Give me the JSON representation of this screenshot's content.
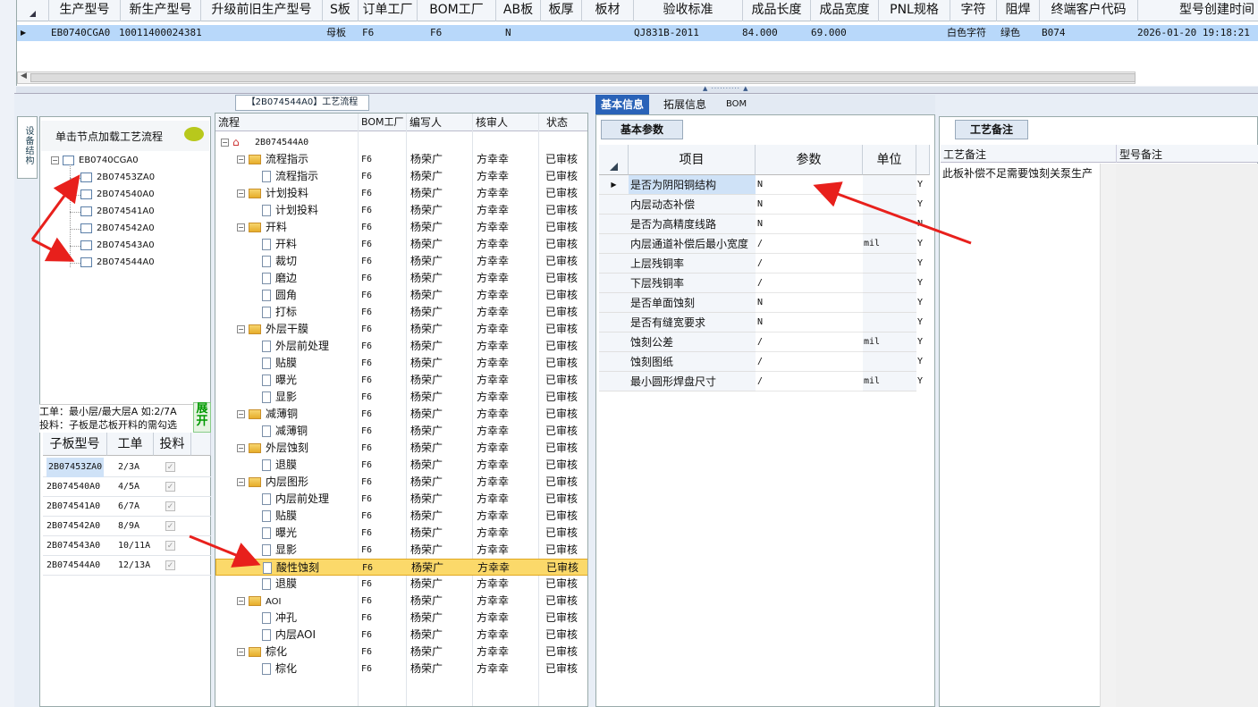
{
  "top_grid": {
    "headers": [
      "生产型号",
      "新生产型号",
      "升级前旧生产型号",
      "S板",
      "订单工厂",
      "BOM工厂",
      "AB板",
      "板厚",
      "板材",
      "验收标准",
      "成品长度",
      "成品宽度",
      "PNL规格",
      "字符",
      "阻焊",
      "终端客户代码",
      "型号创建时间"
    ],
    "row": [
      "EB0740CGA0",
      "10011400024381",
      "",
      "母板",
      "F6",
      "F6",
      "N",
      "",
      "",
      "QJ831B-2011",
      "84.000",
      "69.000",
      "",
      "白色字符",
      "绿色",
      "B074",
      "2026-01-20 19:18:21"
    ]
  },
  "left_panel": {
    "vertical_tab": "设备结构",
    "hint": "单击节点加载工艺流程",
    "tree_root": "EB0740CGA0",
    "tree_children": [
      "2B07453ZA0",
      "2B074540A0",
      "2B074541A0",
      "2B074542A0",
      "2B074543A0",
      "2B074544A0"
    ],
    "info_line1": "工单：最小层/最大层A 如:2/7A",
    "info_line2": "投料：子板是芯板开料的需勾选",
    "expand_label": "展开",
    "sub_headers": [
      "子板型号",
      "工单",
      "投料"
    ],
    "sub_rows": [
      {
        "model": "2B07453ZA0",
        "order": "2/3A"
      },
      {
        "model": "2B074540A0",
        "order": "4/5A"
      },
      {
        "model": "2B074541A0",
        "order": "6/7A"
      },
      {
        "model": "2B074542A0",
        "order": "8/9A"
      },
      {
        "model": "2B074543A0",
        "order": "10/11A"
      },
      {
        "model": "2B074544A0",
        "order": "12/13A"
      }
    ],
    "check_glyph": "✓"
  },
  "process": {
    "title": "【2B074544A0】工艺流程",
    "headers": [
      "流程",
      "BOM工厂",
      "编写人",
      "核审人",
      "状态"
    ],
    "root": "2B074544A0",
    "rows": [
      {
        "level": 1,
        "name": "流程指示",
        "f": "F6",
        "w": "杨荣广",
        "r": "方幸幸",
        "s": "已审核"
      },
      {
        "level": 2,
        "name": "流程指示",
        "f": "F6",
        "w": "杨荣广",
        "r": "方幸幸",
        "s": "已审核"
      },
      {
        "level": 1,
        "name": "计划投料",
        "f": "F6",
        "w": "杨荣广",
        "r": "方幸幸",
        "s": "已审核"
      },
      {
        "level": 2,
        "name": "计划投料",
        "f": "F6",
        "w": "杨荣广",
        "r": "方幸幸",
        "s": "已审核"
      },
      {
        "level": 1,
        "name": "开料",
        "f": "F6",
        "w": "杨荣广",
        "r": "方幸幸",
        "s": "已审核"
      },
      {
        "level": 2,
        "name": "开料",
        "f": "F6",
        "w": "杨荣广",
        "r": "方幸幸",
        "s": "已审核"
      },
      {
        "level": 2,
        "name": "裁切",
        "f": "F6",
        "w": "杨荣广",
        "r": "方幸幸",
        "s": "已审核"
      },
      {
        "level": 2,
        "name": "磨边",
        "f": "F6",
        "w": "杨荣广",
        "r": "方幸幸",
        "s": "已审核"
      },
      {
        "level": 2,
        "name": "圆角",
        "f": "F6",
        "w": "杨荣广",
        "r": "方幸幸",
        "s": "已审核"
      },
      {
        "level": 2,
        "name": "打标",
        "f": "F6",
        "w": "杨荣广",
        "r": "方幸幸",
        "s": "已审核"
      },
      {
        "level": 1,
        "name": "外层干膜",
        "f": "F6",
        "w": "杨荣广",
        "r": "方幸幸",
        "s": "已审核"
      },
      {
        "level": 2,
        "name": "外层前处理",
        "f": "F6",
        "w": "杨荣广",
        "r": "方幸幸",
        "s": "已审核"
      },
      {
        "level": 2,
        "name": "贴膜",
        "f": "F6",
        "w": "杨荣广",
        "r": "方幸幸",
        "s": "已审核"
      },
      {
        "level": 2,
        "name": "曝光",
        "f": "F6",
        "w": "杨荣广",
        "r": "方幸幸",
        "s": "已审核"
      },
      {
        "level": 2,
        "name": "显影",
        "f": "F6",
        "w": "杨荣广",
        "r": "方幸幸",
        "s": "已审核"
      },
      {
        "level": 1,
        "name": "减薄铜",
        "f": "F6",
        "w": "杨荣广",
        "r": "方幸幸",
        "s": "已审核"
      },
      {
        "level": 2,
        "name": "减薄铜",
        "f": "F6",
        "w": "杨荣广",
        "r": "方幸幸",
        "s": "已审核"
      },
      {
        "level": 1,
        "name": "外层蚀刻",
        "f": "F6",
        "w": "杨荣广",
        "r": "方幸幸",
        "s": "已审核"
      },
      {
        "level": 2,
        "name": "退膜",
        "f": "F6",
        "w": "杨荣广",
        "r": "方幸幸",
        "s": "已审核"
      },
      {
        "level": 1,
        "name": "内层图形",
        "f": "F6",
        "w": "杨荣广",
        "r": "方幸幸",
        "s": "已审核"
      },
      {
        "level": 2,
        "name": "内层前处理",
        "f": "F6",
        "w": "杨荣广",
        "r": "方幸幸",
        "s": "已审核"
      },
      {
        "level": 2,
        "name": "贴膜",
        "f": "F6",
        "w": "杨荣广",
        "r": "方幸幸",
        "s": "已审核"
      },
      {
        "level": 2,
        "name": "曝光",
        "f": "F6",
        "w": "杨荣广",
        "r": "方幸幸",
        "s": "已审核"
      },
      {
        "level": 2,
        "name": "显影",
        "f": "F6",
        "w": "杨荣广",
        "r": "方幸幸",
        "s": "已审核"
      },
      {
        "level": 2,
        "name": "酸性蚀刻",
        "f": "F6",
        "w": "杨荣广",
        "r": "方幸幸",
        "s": "已审核",
        "selected": true
      },
      {
        "level": 2,
        "name": "退膜",
        "f": "F6",
        "w": "杨荣广",
        "r": "方幸幸",
        "s": "已审核"
      },
      {
        "level": 1,
        "name": "AOI",
        "f": "F6",
        "w": "杨荣广",
        "r": "方幸幸",
        "s": "已审核"
      },
      {
        "level": 2,
        "name": "冲孔",
        "f": "F6",
        "w": "杨荣广",
        "r": "方幸幸",
        "s": "已审核"
      },
      {
        "level": 2,
        "name": "内层AOI",
        "f": "F6",
        "w": "杨荣广",
        "r": "方幸幸",
        "s": "已审核"
      },
      {
        "level": 1,
        "name": "棕化",
        "f": "F6",
        "w": "杨荣广",
        "r": "方幸幸",
        "s": "已审核"
      },
      {
        "level": 2,
        "name": "棕化",
        "f": "F6",
        "w": "杨荣广",
        "r": "方幸幸",
        "s": "已审核"
      }
    ]
  },
  "right_panel": {
    "tabs": [
      "基本信息",
      "拓展信息",
      "BOM"
    ],
    "sub_tab": "基本参数",
    "headers": [
      "项目",
      "参数",
      "单位"
    ],
    "rows": [
      {
        "item": "是否为阴阳铜结构",
        "param": "N",
        "unit": "",
        "flag": "Y"
      },
      {
        "item": "内层动态补偿",
        "param": "N",
        "unit": "",
        "flag": "Y"
      },
      {
        "item": "是否为高精度线路",
        "param": "N",
        "unit": "",
        "flag": "N"
      },
      {
        "item": "内层通道补偿后最小宽度",
        "param": "/",
        "unit": "mil",
        "flag": "Y"
      },
      {
        "item": "上层残铜率",
        "param": "/",
        "unit": "",
        "flag": "Y"
      },
      {
        "item": "下层残铜率",
        "param": "/",
        "unit": "",
        "flag": "Y"
      },
      {
        "item": "是否单面蚀刻",
        "param": "N",
        "unit": "",
        "flag": "Y"
      },
      {
        "item": "是否有缝宽要求",
        "param": "N",
        "unit": "",
        "flag": "Y"
      },
      {
        "item": "蚀刻公差",
        "param": "/",
        "unit": "mil",
        "flag": "Y"
      },
      {
        "item": "蚀刻图纸",
        "param": "/",
        "unit": "",
        "flag": "Y"
      },
      {
        "item": "最小圆形焊盘尺寸",
        "param": "/",
        "unit": "mil",
        "flag": "Y"
      }
    ]
  },
  "remarks": {
    "tab": "工艺备注",
    "headers": [
      "工艺备注",
      "型号备注"
    ],
    "text": "此板补偿不足需要蚀刻关泵生产"
  },
  "colors": {
    "arrow": "#e8201c",
    "selected_row": "#fbd96a",
    "top_row": "#b8d8fa",
    "active_tab": "#2a63b8"
  }
}
